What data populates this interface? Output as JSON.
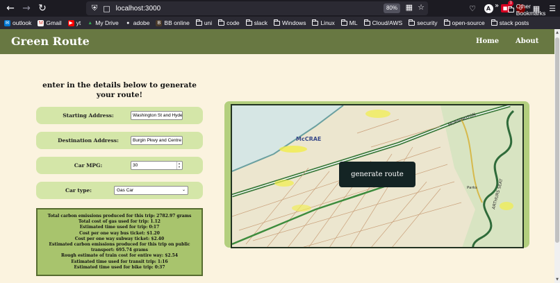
{
  "browser": {
    "url": "localhost:3000",
    "zoom": "80%",
    "toolbar_badge": "3",
    "bookmarks": [
      {
        "label": "outlook",
        "icon": "outlook-icon"
      },
      {
        "label": "Gmail",
        "icon": "gmail-icon"
      },
      {
        "label": "yt",
        "icon": "youtube-icon"
      },
      {
        "label": "My Drive",
        "icon": "drive-icon"
      },
      {
        "label": "adobe",
        "icon": "globe-icon"
      },
      {
        "label": "BB online",
        "icon": "bb-icon"
      },
      {
        "label": "uni",
        "icon": "folder-icon"
      },
      {
        "label": "code",
        "icon": "folder-icon"
      },
      {
        "label": "slack",
        "icon": "folder-icon"
      },
      {
        "label": "Windows",
        "icon": "folder-icon"
      },
      {
        "label": "Linux",
        "icon": "folder-icon"
      },
      {
        "label": "ML",
        "icon": "folder-icon"
      },
      {
        "label": "Cloud/AWS",
        "icon": "folder-icon"
      },
      {
        "label": "security",
        "icon": "folder-icon"
      },
      {
        "label": "open-source",
        "icon": "folder-icon"
      },
      {
        "label": "stack posts",
        "icon": "folder-icon"
      }
    ],
    "other_bookmarks": "Other Bookmarks"
  },
  "header": {
    "brand": "Green Route",
    "nav": [
      {
        "label": "Home"
      },
      {
        "label": "About"
      }
    ],
    "bg_color": "#687842"
  },
  "form": {
    "title": "enter in the details below to generate your route!",
    "start": {
      "label": "Starting Address:",
      "value": "Washington St and Hyde"
    },
    "destination": {
      "label": "Destination Address:",
      "value": "Burgin Pkwy and Centre"
    },
    "mpg": {
      "label": "Car MPG:",
      "value": "30"
    },
    "car_type": {
      "label": "Car type:",
      "selected": "Gas Car"
    }
  },
  "results": {
    "lines": [
      "Total carbon emissions produced for this trip: 2782.97 grams",
      "Total cost of gas used for trip: 1.12",
      "Estimated time used for trip: 0:17",
      "Cost per one way bus ticket: $1.20",
      "Cost per one way subway ticket: $2.40",
      "Estimated carbon emissions produced for this trip on public transport: 695.74 grams",
      "Rough estimate of train cost for entire way: $2.54",
      "Estimated time used for transit trip: 1:16",
      "Estimated time used for bike trip: 0:37"
    ]
  },
  "map": {
    "button_label": "generate route",
    "labels": {
      "mccrae": "McCRAE",
      "mornington": "MORNINGTON",
      "arthurs_seat": "ARTHURS SEAT",
      "parks": "Parks"
    }
  }
}
